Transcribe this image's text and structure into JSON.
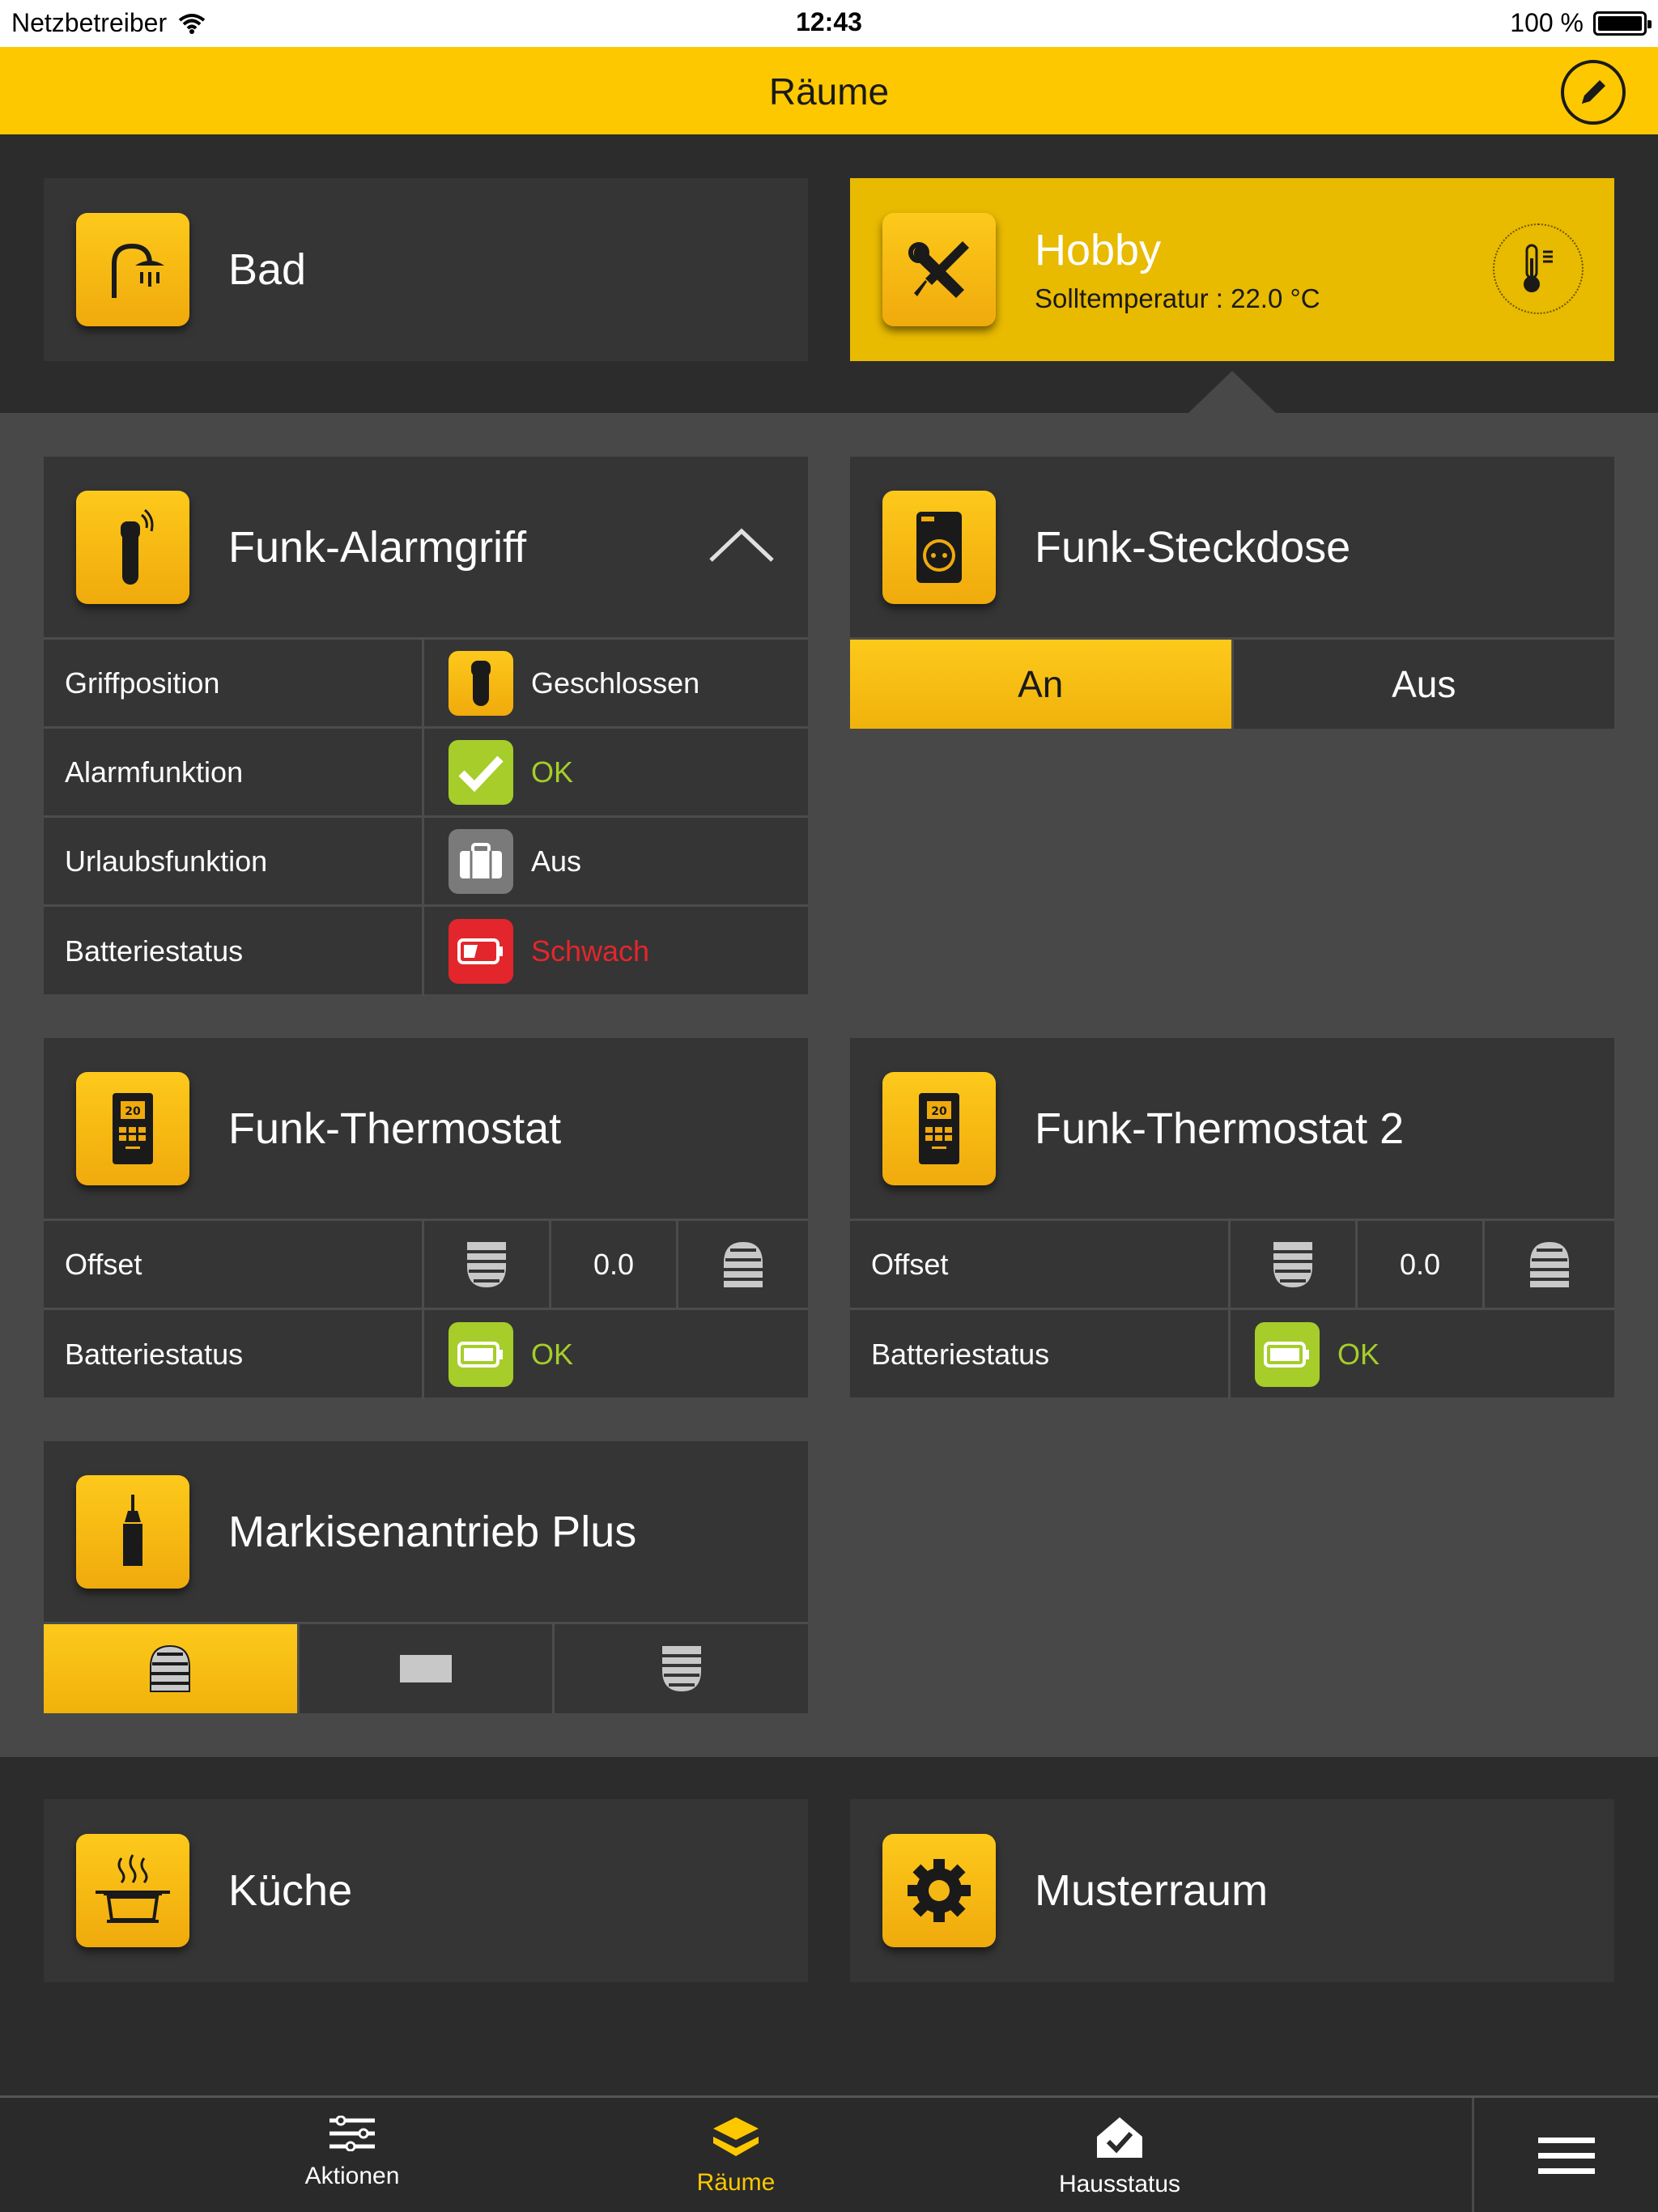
{
  "status_bar": {
    "carrier": "Netzbetreiber",
    "time": "12:43",
    "battery": "100 %"
  },
  "header": {
    "title": "Räume"
  },
  "rooms": {
    "bad": {
      "name": "Bad"
    },
    "hobby": {
      "name": "Hobby",
      "subtitle": "Solltemperatur : 22.0 °C"
    },
    "kueche": {
      "name": "Küche"
    },
    "musterraum": {
      "name": "Musterraum"
    }
  },
  "devices": {
    "alarmgriff": {
      "name": "Funk-Alarmgriff",
      "rows": [
        {
          "label": "Griffposition",
          "value": "Geschlossen"
        },
        {
          "label": "Alarmfunktion",
          "value": "OK"
        },
        {
          "label": "Urlaubsfunktion",
          "value": "Aus"
        },
        {
          "label": "Batteriestatus",
          "value": "Schwach"
        }
      ]
    },
    "steckdose": {
      "name": "Funk-Steckdose",
      "on_label": "An",
      "off_label": "Aus",
      "state": "An"
    },
    "thermostat1": {
      "name": "Funk-Thermostat",
      "offset_label": "Offset",
      "offset_value": "0.0",
      "battery_label": "Batteriestatus",
      "battery_value": "OK"
    },
    "thermostat2": {
      "name": "Funk-Thermostat 2",
      "offset_label": "Offset",
      "offset_value": "0.0",
      "battery_label": "Batteriestatus",
      "battery_value": "OK"
    },
    "markise": {
      "name": "Markisenantrieb Plus"
    }
  },
  "tabs": [
    {
      "label": "Aktionen",
      "icon": "actions-icon"
    },
    {
      "label": "Räume",
      "icon": "rooms-icon",
      "active": true
    },
    {
      "label": "Hausstatus",
      "icon": "house-status-icon"
    }
  ],
  "colors": {
    "accent": "#fdc800",
    "ok": "#a6cd2a",
    "warning": "#e3262c",
    "panel": "#353535"
  }
}
